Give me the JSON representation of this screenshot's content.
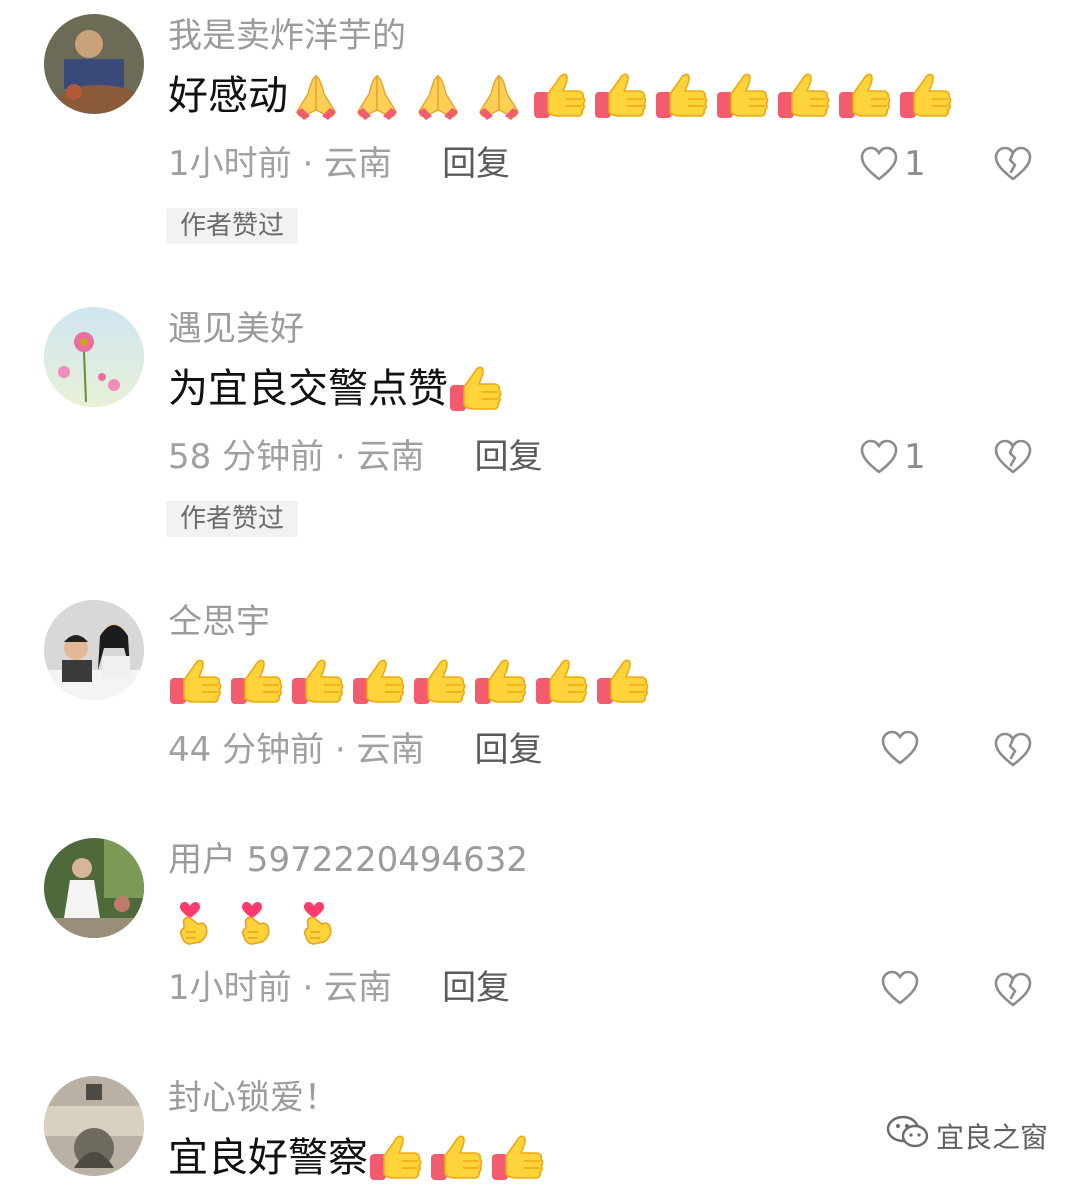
{
  "comments": [
    {
      "username": "我是卖炸洋芋的",
      "text": "好感动",
      "emojis": [
        "pray-emoji",
        "pray-emoji",
        "pray-emoji",
        "pray-emoji",
        "thumbs-up-emoji",
        "thumbs-up-emoji",
        "thumbs-up-emoji",
        "thumbs-up-emoji",
        "thumbs-up-emoji",
        "thumbs-up-emoji",
        "thumbs-up-emoji"
      ],
      "time_location": "1小时前 · 云南",
      "reply_label": "回复",
      "like_count": "1",
      "badge": "作者赞过"
    },
    {
      "username": "遇见美好",
      "text": "为宜良交警点赞",
      "emojis": [
        "thumbs-up-emoji"
      ],
      "time_location": "58 分钟前 · 云南",
      "reply_label": "回复",
      "like_count": "1",
      "badge": "作者赞过"
    },
    {
      "username": "仝思宇",
      "text": "",
      "emojis": [
        "thumbs-up-emoji",
        "thumbs-up-emoji",
        "thumbs-up-emoji",
        "thumbs-up-emoji",
        "thumbs-up-emoji",
        "thumbs-up-emoji",
        "thumbs-up-emoji",
        "thumbs-up-emoji"
      ],
      "time_location": "44 分钟前 · 云南",
      "reply_label": "回复",
      "like_count": "",
      "badge": ""
    },
    {
      "username": "用户 5972220494632",
      "text": "",
      "emojis": [
        "finger-heart-emoji",
        "finger-heart-emoji",
        "finger-heart-emoji"
      ],
      "time_location": "1小时前 · 云南",
      "reply_label": "回复",
      "like_count": "",
      "badge": ""
    },
    {
      "username": "封心锁爱！",
      "text": "宜良好警察",
      "emojis": [
        "thumbs-up-emoji",
        "thumbs-up-emoji",
        "thumbs-up-emoji"
      ],
      "time_location": "",
      "reply_label": "",
      "like_count": "",
      "badge": ""
    }
  ],
  "watermark": {
    "label": "宜良之窗",
    "icon": "wechat-icon"
  },
  "colors": {
    "username": "#9b9b9b",
    "meta": "#a0a0a0",
    "badge_bg": "#f2f2f2"
  }
}
